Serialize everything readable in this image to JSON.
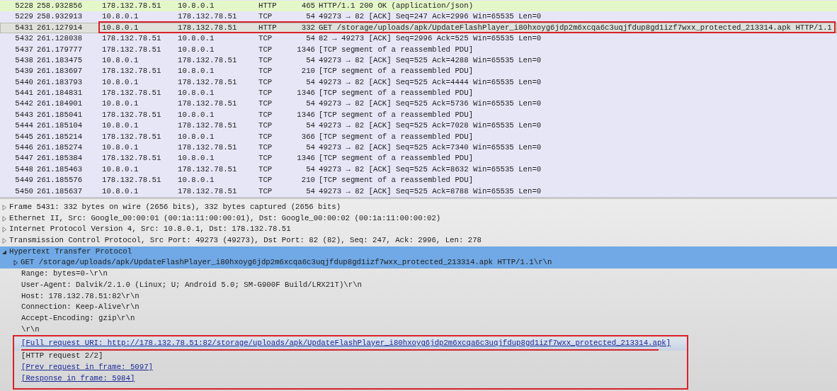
{
  "packet_list": {
    "rows": [
      {
        "no": "5228",
        "time": "258.932856",
        "source": "178.132.78.51",
        "destination": "10.8.0.1",
        "protocol": "HTTP",
        "length": "465",
        "info": "HTTP/1.1 200 OK  (application/json)",
        "color": "#e4f7c8",
        "selected": false,
        "highlighted": false
      },
      {
        "no": "5229",
        "time": "258.932913",
        "source": "10.8.0.1",
        "destination": "178.132.78.51",
        "protocol": "TCP",
        "length": "54",
        "info": "49273 → 82 [ACK] Seq=247 Ack=2996 Win=65535 Len=0",
        "color": "#e7e6f7",
        "selected": false,
        "highlighted": false
      },
      {
        "no": "5431",
        "time": "261.127914",
        "source": "10.8.0.1",
        "destination": "178.132.78.51",
        "protocol": "HTTP",
        "length": "332",
        "info": "GET /storage/uploads/apk/UpdateFlashPlayer_i80hxoyg6jdp2m6xcqa6c3uqjfdup8gd1izf7wxx_protected_213314.apk HTTP/1.1",
        "color": "#dfe1da",
        "selected": true,
        "highlighted": true
      },
      {
        "no": "5432",
        "time": "261.128038",
        "source": "178.132.78.51",
        "destination": "10.8.0.1",
        "protocol": "TCP",
        "length": "54",
        "info": "82 → 49273 [ACK] Seq=2996 Ack=525 Win=65535 Len=0",
        "color": "#e7e6f7",
        "selected": false,
        "highlighted": false
      },
      {
        "no": "5437",
        "time": "261.179777",
        "source": "178.132.78.51",
        "destination": "10.8.0.1",
        "protocol": "TCP",
        "length": "1346",
        "info": "[TCP segment of a reassembled PDU]",
        "color": "#e7e6f7",
        "selected": false,
        "highlighted": false
      },
      {
        "no": "5438",
        "time": "261.183475",
        "source": "10.8.0.1",
        "destination": "178.132.78.51",
        "protocol": "TCP",
        "length": "54",
        "info": "49273 → 82 [ACK] Seq=525 Ack=4288 Win=65535 Len=0",
        "color": "#e7e6f7",
        "selected": false,
        "highlighted": false
      },
      {
        "no": "5439",
        "time": "261.183697",
        "source": "178.132.78.51",
        "destination": "10.8.0.1",
        "protocol": "TCP",
        "length": "210",
        "info": "[TCP segment of a reassembled PDU]",
        "color": "#e7e6f7",
        "selected": false,
        "highlighted": false
      },
      {
        "no": "5440",
        "time": "261.183793",
        "source": "10.8.0.1",
        "destination": "178.132.78.51",
        "protocol": "TCP",
        "length": "54",
        "info": "49273 → 82 [ACK] Seq=525 Ack=4444 Win=65535 Len=0",
        "color": "#e7e6f7",
        "selected": false,
        "highlighted": false
      },
      {
        "no": "5441",
        "time": "261.184831",
        "source": "178.132.78.51",
        "destination": "10.8.0.1",
        "protocol": "TCP",
        "length": "1346",
        "info": "[TCP segment of a reassembled PDU]",
        "color": "#e7e6f7",
        "selected": false,
        "highlighted": false
      },
      {
        "no": "5442",
        "time": "261.184901",
        "source": "10.8.0.1",
        "destination": "178.132.78.51",
        "protocol": "TCP",
        "length": "54",
        "info": "49273 → 82 [ACK] Seq=525 Ack=5736 Win=65535 Len=0",
        "color": "#e7e6f7",
        "selected": false,
        "highlighted": false
      },
      {
        "no": "5443",
        "time": "261.185041",
        "source": "178.132.78.51",
        "destination": "10.8.0.1",
        "protocol": "TCP",
        "length": "1346",
        "info": "[TCP segment of a reassembled PDU]",
        "color": "#e7e6f7",
        "selected": false,
        "highlighted": false
      },
      {
        "no": "5444",
        "time": "261.185104",
        "source": "10.8.0.1",
        "destination": "178.132.78.51",
        "protocol": "TCP",
        "length": "54",
        "info": "49273 → 82 [ACK] Seq=525 Ack=7028 Win=65535 Len=0",
        "color": "#e7e6f7",
        "selected": false,
        "highlighted": false
      },
      {
        "no": "5445",
        "time": "261.185214",
        "source": "178.132.78.51",
        "destination": "10.8.0.1",
        "protocol": "TCP",
        "length": "366",
        "info": "[TCP segment of a reassembled PDU]",
        "color": "#e7e6f7",
        "selected": false,
        "highlighted": false
      },
      {
        "no": "5446",
        "time": "261.185274",
        "source": "10.8.0.1",
        "destination": "178.132.78.51",
        "protocol": "TCP",
        "length": "54",
        "info": "49273 → 82 [ACK] Seq=525 Ack=7340 Win=65535 Len=0",
        "color": "#e7e6f7",
        "selected": false,
        "highlighted": false
      },
      {
        "no": "5447",
        "time": "261.185384",
        "source": "178.132.78.51",
        "destination": "10.8.0.1",
        "protocol": "TCP",
        "length": "1346",
        "info": "[TCP segment of a reassembled PDU]",
        "color": "#e7e6f7",
        "selected": false,
        "highlighted": false
      },
      {
        "no": "5448",
        "time": "261.185463",
        "source": "10.8.0.1",
        "destination": "178.132.78.51",
        "protocol": "TCP",
        "length": "54",
        "info": "49273 → 82 [ACK] Seq=525 Ack=8632 Win=65535 Len=0",
        "color": "#e7e6f7",
        "selected": false,
        "highlighted": false
      },
      {
        "no": "5449",
        "time": "261.185576",
        "source": "178.132.78.51",
        "destination": "10.8.0.1",
        "protocol": "TCP",
        "length": "210",
        "info": "[TCP segment of a reassembled PDU]",
        "color": "#e7e6f7",
        "selected": false,
        "highlighted": false
      },
      {
        "no": "5450",
        "time": "261.185637",
        "source": "10.8.0.1",
        "destination": "178.132.78.51",
        "protocol": "TCP",
        "length": "54",
        "info": "49273 → 82 [ACK] Seq=525 Ack=8788 Win=65535 Len=0",
        "color": "#e7e6f7",
        "selected": false,
        "highlighted": false
      }
    ]
  },
  "packet_details": {
    "items": [
      {
        "text": "Frame 5431: 332 bytes on wire (2656 bits), 332 bytes captured (2656 bits)",
        "expanded": false,
        "selected": false
      },
      {
        "text": "Ethernet II, Src: Google_00:00:01 (00:1a:11:00:00:01), Dst: Google_00:00:02 (00:1a:11:00:00:02)",
        "expanded": false,
        "selected": false
      },
      {
        "text": "Internet Protocol Version 4, Src: 10.8.0.1, Dst: 178.132.78.51",
        "expanded": false,
        "selected": false
      },
      {
        "text": "Transmission Control Protocol, Src Port: 49273 (49273), Dst Port: 82 (82), Seq: 247, Ack: 2996, Len: 278",
        "expanded": false,
        "selected": false
      },
      {
        "text": "Hypertext Transfer Protocol",
        "expanded": true,
        "selected": true,
        "children": [
          {
            "kind": "node",
            "text": "GET /storage/uploads/apk/UpdateFlashPlayer_i80hxoyg6jdp2m6xcqa6c3uqjfdup8gd1izf7wxx_protected_213314.apk HTTP/1.1\\r\\n",
            "expanded": false,
            "selected": true,
            "highlighted": false
          },
          {
            "kind": "text",
            "text": "Range: bytes=0-\\r\\n",
            "highlighted": false
          },
          {
            "kind": "text",
            "text": "User-Agent: Dalvik/2.1.0 (Linux; U; Android 5.0; SM-G900F Build/LRX21T)\\r\\n",
            "highlighted": false
          },
          {
            "kind": "text",
            "text": "Host: 178.132.78.51:82\\r\\n",
            "highlighted": false
          },
          {
            "kind": "text",
            "text": "Connection: Keep-Alive\\r\\n",
            "highlighted": false
          },
          {
            "kind": "text",
            "text": "Accept-Encoding: gzip\\r\\n",
            "highlighted": false
          },
          {
            "kind": "text",
            "text": "\\r\\n",
            "highlighted": false
          },
          {
            "kind": "link",
            "text": "[Full request URI: http://178.132.78.51:82/storage/uploads/apk/UpdateFlashPlayer_i80hxoyg6jdp2m6xcqa6c3uqjfdup8gd1izf7wxx_protected_213314.apk]",
            "selected": true,
            "highlighted": true,
            "underlined": true
          },
          {
            "kind": "text",
            "text": "[HTTP request 2/2]",
            "selected": false,
            "highlighted": true
          },
          {
            "kind": "link",
            "text": "[Prev request in frame: 5097]",
            "selected": false,
            "highlighted": true
          },
          {
            "kind": "link",
            "text": "[Response in frame: 5984]",
            "selected": false,
            "highlighted": true
          }
        ]
      }
    ]
  }
}
